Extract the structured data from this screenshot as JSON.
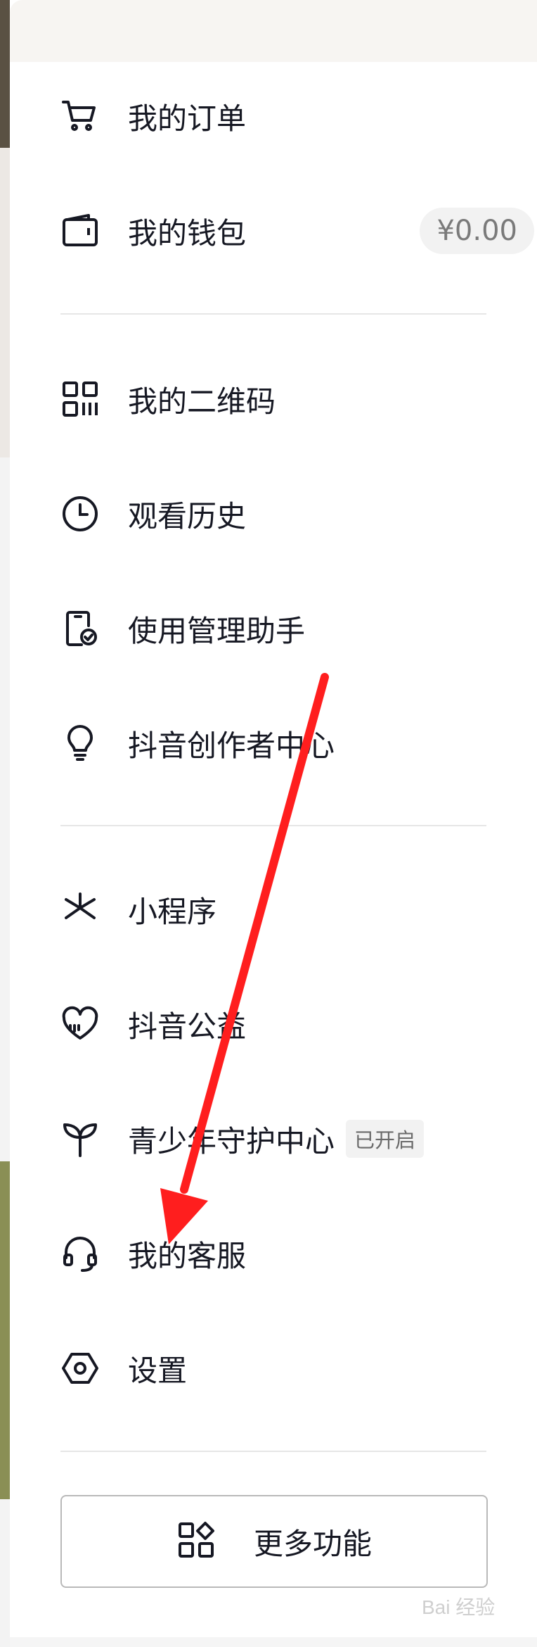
{
  "menu": {
    "orders": {
      "label": "我的订单",
      "icon": "cart-icon"
    },
    "wallet": {
      "label": "我的钱包",
      "icon": "wallet-icon",
      "balance": "¥0.00"
    },
    "qrcode": {
      "label": "我的二维码",
      "icon": "qrcode-icon"
    },
    "history": {
      "label": "观看历史",
      "icon": "clock-icon"
    },
    "usage_manager": {
      "label": "使用管理助手",
      "icon": "phone-check-icon"
    },
    "creator_center": {
      "label": "抖音创作者中心",
      "icon": "lightbulb-icon"
    },
    "mini_programs": {
      "label": "小程序",
      "icon": "mini-program-icon"
    },
    "charity": {
      "label": "抖音公益",
      "icon": "heart-icon"
    },
    "youth_protection": {
      "label": "青少年守护中心",
      "icon": "sprout-icon",
      "status": "已开启"
    },
    "customer_service": {
      "label": "我的客服",
      "icon": "headset-icon"
    },
    "settings": {
      "label": "设置",
      "icon": "hexagon-settings-icon"
    }
  },
  "more_button": {
    "label": "更多功能",
    "icon": "grid-icon"
  },
  "watermark": "Bai 经验",
  "colors": {
    "text": "#161823",
    "arrow": "#ff1e1e",
    "divider": "#e6e6e6"
  }
}
